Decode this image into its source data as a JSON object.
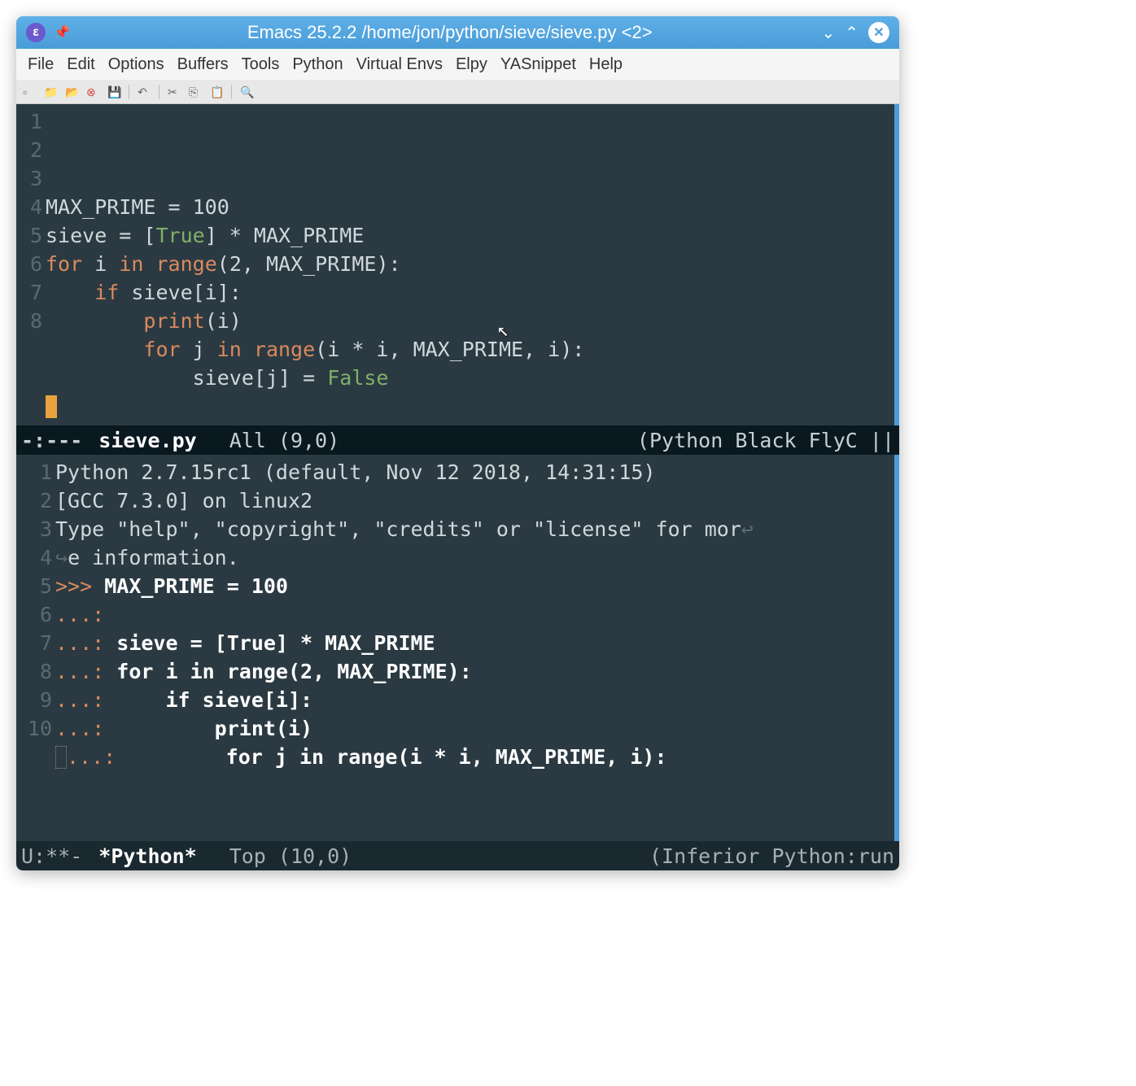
{
  "titlebar": {
    "app_icon_text": "ε",
    "title": "Emacs 25.2.2 /home/jon/python/sieve/sieve.py <2>"
  },
  "menubar": {
    "items": [
      "File",
      "Edit",
      "Options",
      "Buffers",
      "Tools",
      "Python",
      "Virtual Envs",
      "Elpy",
      "YASnippet",
      "Help"
    ]
  },
  "toolbar": {
    "icons": [
      "new-file",
      "open-folder",
      "folder",
      "close",
      "save",
      "undo",
      "cut",
      "copy",
      "paste",
      "search"
    ]
  },
  "top_pane": {
    "line_numbers": [
      "1",
      "2",
      "3",
      "4",
      "5",
      "6",
      "7",
      "8",
      ""
    ],
    "code": [
      {
        "tokens": [
          {
            "t": "MAX_PRIME = ",
            "c": ""
          },
          {
            "t": "100",
            "c": ""
          }
        ]
      },
      {
        "tokens": []
      },
      {
        "tokens": [
          {
            "t": "sieve = [",
            "c": ""
          },
          {
            "t": "True",
            "c": "const"
          },
          {
            "t": "] * MAX_PRIME",
            "c": ""
          }
        ]
      },
      {
        "tokens": [
          {
            "t": "for",
            "c": "kw"
          },
          {
            "t": " i ",
            "c": ""
          },
          {
            "t": "in",
            "c": "kw"
          },
          {
            "t": " ",
            "c": ""
          },
          {
            "t": "range",
            "c": "kw"
          },
          {
            "t": "(",
            "c": ""
          },
          {
            "t": "2",
            "c": ""
          },
          {
            "t": ", MAX_PRIME):",
            "c": ""
          }
        ]
      },
      {
        "tokens": [
          {
            "t": "    ",
            "c": ""
          },
          {
            "t": "if",
            "c": "kw"
          },
          {
            "t": " sieve[i]:",
            "c": ""
          }
        ]
      },
      {
        "tokens": [
          {
            "t": "        ",
            "c": ""
          },
          {
            "t": "print",
            "c": "kw"
          },
          {
            "t": "(i)",
            "c": ""
          }
        ]
      },
      {
        "tokens": [
          {
            "t": "        ",
            "c": ""
          },
          {
            "t": "for",
            "c": "kw"
          },
          {
            "t": " j ",
            "c": ""
          },
          {
            "t": "in",
            "c": "kw"
          },
          {
            "t": " ",
            "c": ""
          },
          {
            "t": "range",
            "c": "kw"
          },
          {
            "t": "(i * i, MAX_PRIME, i):",
            "c": ""
          }
        ]
      },
      {
        "tokens": [
          {
            "t": "            sieve[j] = ",
            "c": ""
          },
          {
            "t": "False",
            "c": "const"
          }
        ]
      },
      {
        "cursor": true
      }
    ]
  },
  "modeline_top": {
    "status": "-:---",
    "file": "sieve.py",
    "pos": "All (9,0)",
    "modes": "(Python Black FlyC ||"
  },
  "bottom_pane": {
    "line_numbers": [
      "1",
      "2",
      "3",
      "",
      "4",
      "5",
      "6",
      "7",
      "8",
      "9",
      "10"
    ],
    "lines": [
      {
        "text": "Python 2.7.15rc1 (default, Nov 12 2018, 14:31:15)"
      },
      {
        "text": "[GCC 7.3.0] on linux2"
      },
      {
        "text": "Type \"help\", \"copyright\", \"credits\" or \"license\" for mor",
        "wrap": true
      },
      {
        "cont": "↪",
        "text": "e information."
      },
      {
        "prompt": ">>> ",
        "bold": "MAX_PRIME = 100"
      },
      {
        "prompt": "...: ",
        "bold": ""
      },
      {
        "prompt": "...: ",
        "bold": "sieve = [True] * MAX_PRIME"
      },
      {
        "prompt": "...: ",
        "bold": "for i in range(2, MAX_PRIME):"
      },
      {
        "prompt": "...: ",
        "bold": "    if sieve[i]:"
      },
      {
        "prompt": "...: ",
        "bold": "        print(i)"
      },
      {
        "prompt": "...: ",
        "bold": "        for j in range(i * i, MAX_PRIME, i):",
        "cursor_pre": true
      }
    ]
  },
  "modeline_bottom": {
    "status": "U:**-",
    "file": "*Python*",
    "pos": "Top (10,0)",
    "modes": "(Inferior Python:run "
  }
}
